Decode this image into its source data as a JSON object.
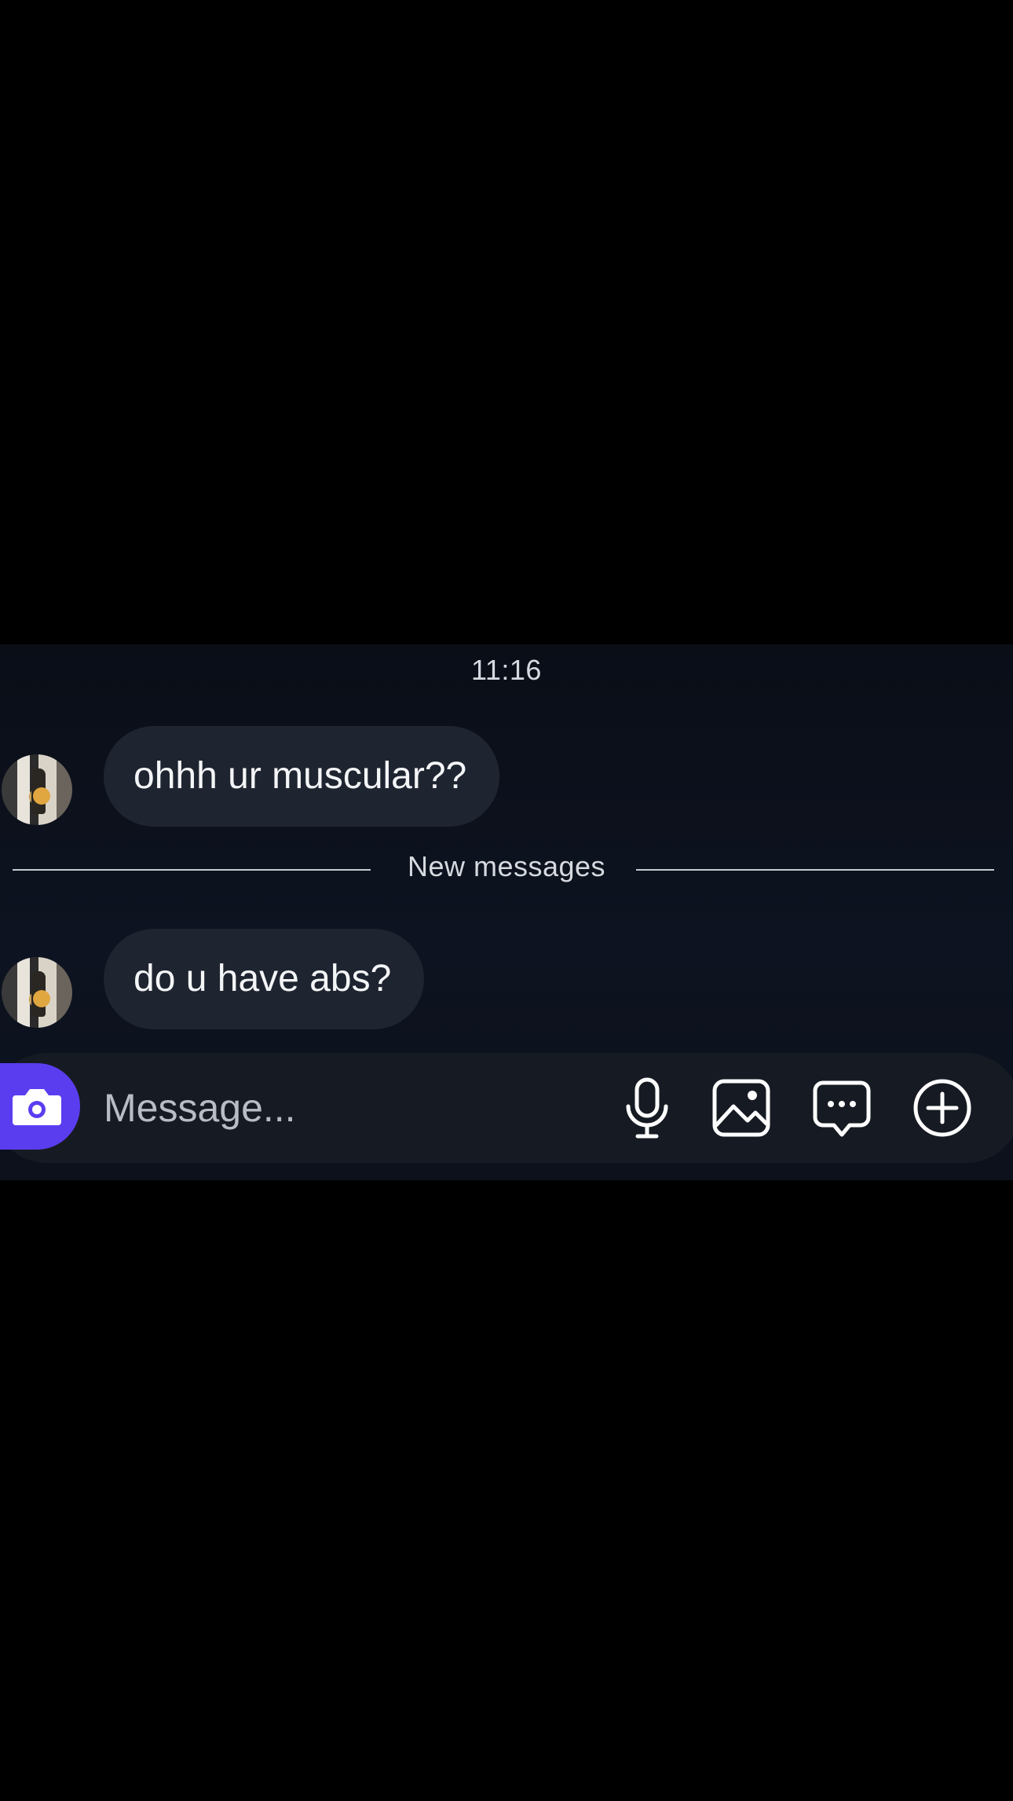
{
  "chat": {
    "timestamp": "11:16",
    "messages": [
      {
        "text": "ohhh ur muscular??",
        "avatar": "profile-photo"
      },
      {
        "text": "do u have abs?",
        "avatar": "profile-photo"
      }
    ],
    "divider_label": "New messages"
  },
  "composer": {
    "placeholder": "Message...",
    "camera_icon": "camera-icon",
    "mic_icon": "microphone-icon",
    "gallery_icon": "image-icon",
    "sticker_icon": "chat-bubble-icon",
    "plus_icon": "plus-circle-icon",
    "accent_color": "#5b3df0"
  }
}
